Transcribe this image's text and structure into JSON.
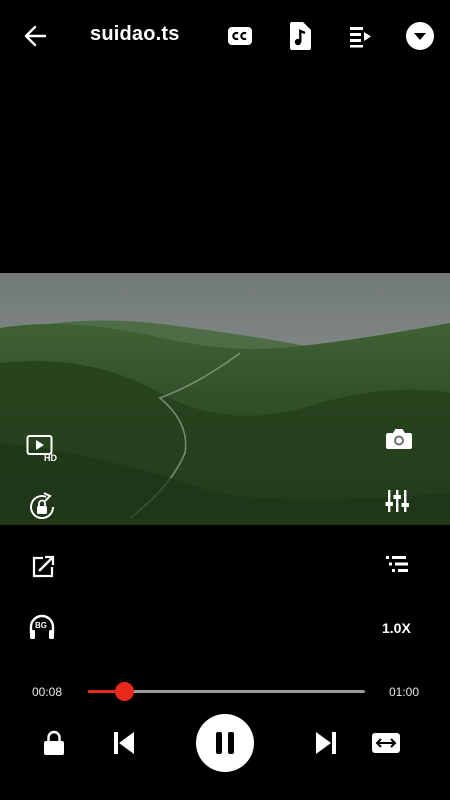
{
  "header": {
    "title": "suidao.ts",
    "icons": [
      "back-arrow-icon",
      "closed-captions-icon",
      "audio-track-icon",
      "playlist-icon",
      "dropdown-menu-icon"
    ]
  },
  "video_overlay": {
    "icons": [
      "hd-resolution-icon",
      "rotation-lock-icon",
      "screenshot-camera-icon",
      "equalizer-icon"
    ]
  },
  "controls": {
    "speed_label": "1.0X",
    "bg_play_badge": "BG",
    "icons": [
      "popup-window-icon",
      "chapters-list-icon",
      "background-play-headphones-icon"
    ]
  },
  "playback": {
    "current_time": "00:08",
    "total_time": "01:00",
    "progress": 0.133,
    "accent_color": "#e8291c",
    "icons": [
      "screen-lock-icon",
      "previous-icon",
      "pause-icon",
      "next-icon",
      "aspect-ratio-icon"
    ]
  }
}
